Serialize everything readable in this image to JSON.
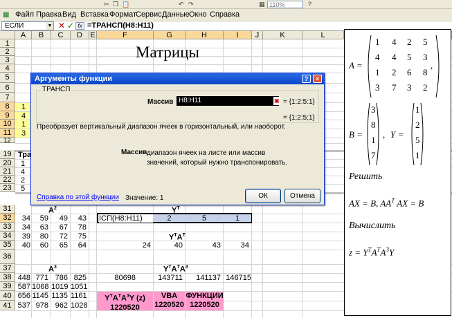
{
  "menu": {
    "items": [
      "Файл",
      "Правка",
      "Вид",
      "Вставка",
      "Формат",
      "Сервис",
      "Данные",
      "Окно",
      "Справка"
    ],
    "zoom": "110%"
  },
  "formula_bar": {
    "name_box": "ЕСЛИ",
    "formula": "=ТРАНСП(H8:H11)"
  },
  "columns": [
    "A",
    "B",
    "C",
    "D",
    "E",
    "F",
    "G",
    "H",
    "I",
    "J",
    "K",
    "L",
    "M",
    "N",
    "O"
  ],
  "rows": {
    "top": [
      "1",
      "2",
      "3",
      "4",
      "5",
      "6",
      "7",
      "8",
      "9",
      "10",
      "11",
      "12"
    ],
    "middle": [
      "19",
      "20",
      "21",
      "22",
      "23"
    ],
    "bottom": [
      "31",
      "32",
      "33",
      "34",
      "35",
      "36",
      "37",
      "38",
      "39",
      "40",
      "41"
    ]
  },
  "sheet": {
    "title": "Матрицы",
    "col_a_values": [
      "1",
      "4",
      "1",
      "3"
    ],
    "a_row19_label": "Тра",
    "a_rows_20_23": [
      "1",
      "4",
      "2",
      "5"
    ],
    "heading_a2": "A",
    "heading_a2_sup": "2",
    "heading_yt": "Y",
    "heading_yt_sup": "T",
    "a2_matrix": [
      [
        "34",
        "59",
        "49",
        "43"
      ],
      [
        "34",
        "63",
        "67",
        "78"
      ],
      [
        "39",
        "80",
        "72",
        "75"
      ],
      [
        "40",
        "60",
        "65",
        "64"
      ]
    ],
    "editing_cell": "ІСП(H8:H11)",
    "yt_values": [
      "2",
      "5",
      "1"
    ],
    "heading_yta": "Y",
    "heading_yta_sup1": "T",
    "heading_yta_a": "A",
    "heading_yta_sup2": "T",
    "yta_values": [
      "24",
      "40",
      "43",
      "34"
    ],
    "heading_a3": "A",
    "heading_a3_sup": "3",
    "heading_ytata": "Y",
    "heading_ytata_sup1": "T",
    "heading_ytata_a1": "A",
    "heading_ytata_sup2": "T",
    "heading_ytata_a2": "A",
    "heading_ytata_sup3": "3",
    "a3_matrix": [
      [
        "448",
        "771",
        "786",
        "825"
      ],
      [
        "587",
        "1068",
        "1019",
        "1051"
      ],
      [
        "656",
        "1145",
        "1135",
        "1161"
      ],
      [
        "537",
        "978",
        "962",
        "1028"
      ]
    ],
    "ytata_values": [
      "80698",
      "143711",
      "141137",
      "146715"
    ],
    "result_label_prefix": "Y",
    "result_label_sup1": "T",
    "result_label_a1": "A",
    "result_label_sup2": "T",
    "result_label_a2": "A",
    "result_label_sup3": "3",
    "result_label_suffix": "Y   (z)",
    "result_value": "1220520",
    "vba_label": "VBA",
    "vba_value": "1220520",
    "functions_label": "ФУНКЦИИ",
    "functions_value": "1220520",
    "highlight_color": "#ff99cc"
  },
  "matrix_panel": {
    "a_label": "A =",
    "a_matrix": [
      [
        "1",
        "4",
        "2",
        "5"
      ],
      [
        "4",
        "4",
        "5",
        "3"
      ],
      [
        "1",
        "2",
        "6",
        "8"
      ],
      [
        "3",
        "7",
        "3",
        "2"
      ]
    ],
    "b_label": "B =",
    "b_vector": [
      "3",
      "8",
      "1",
      "7"
    ],
    "y_label": "Y =",
    "y_vector": [
      "1",
      "2",
      "5",
      "1"
    ],
    "solve_heading": "Решить",
    "equation": "AX = B,  AA",
    "equation_sup": "T",
    "equation_rest": "AX = B",
    "compute_heading": "Вычислить",
    "z_formula": "z = Y",
    "z_sup1": "T",
    "z_a1": "A",
    "z_sup2": "T",
    "z_a2": "A",
    "z_sup3": "3",
    "z_end": "Y"
  },
  "dialog": {
    "title": "Аргументы функции",
    "group_label": "ТРАНСП",
    "arg_label": "Массив",
    "arg_value": "H8:H11",
    "arg_result": "= {1:2:5:1}",
    "result": "= {1;2;5;1}",
    "description": "Преобразует вертикальный диапазон ячеек в горизонтальный, или наоборот.",
    "arg_desc_name": "Массив",
    "arg_desc_text": "диапазон ячеек на листе или массив значений, который нужно транспонировать.",
    "help_link": "Справка по этой функции",
    "value_label": "Значение:",
    "value_result": "1",
    "ok_label": "ОК",
    "cancel_label": "Отмена"
  }
}
